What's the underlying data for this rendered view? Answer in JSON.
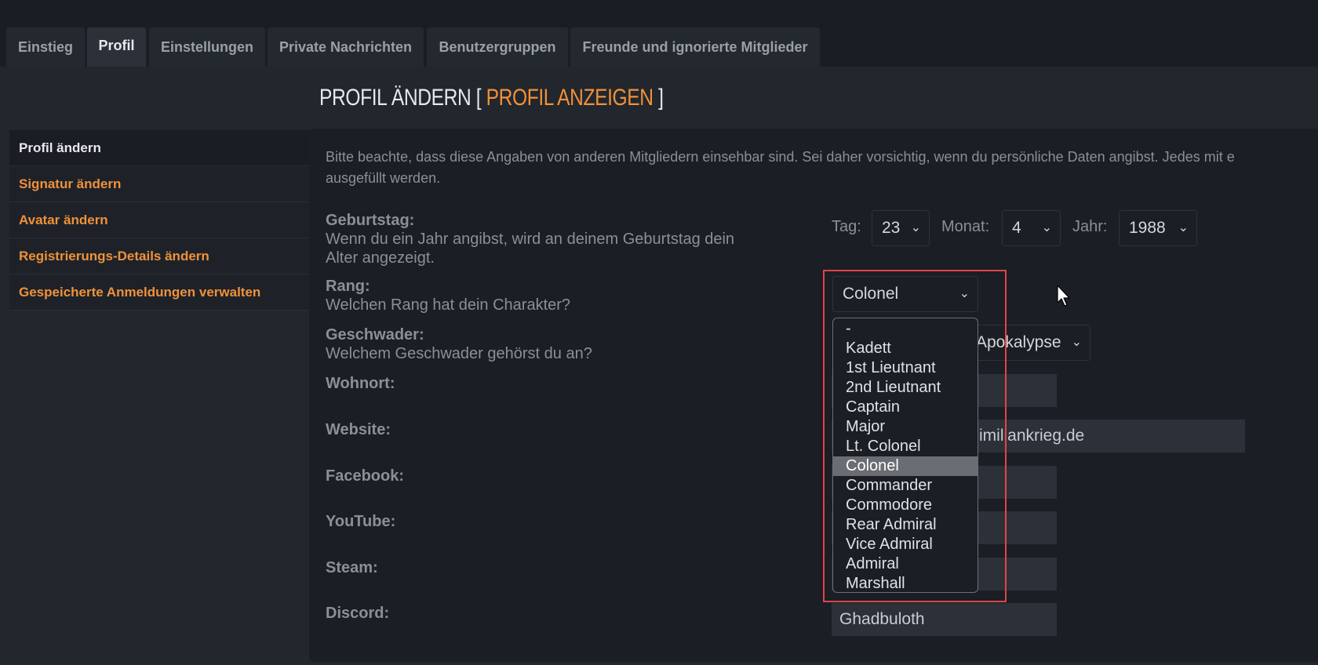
{
  "tabs": [
    {
      "label": "Einstieg"
    },
    {
      "label": "Profil"
    },
    {
      "label": "Einstellungen"
    },
    {
      "label": "Private Nachrichten"
    },
    {
      "label": "Benutzergruppen"
    },
    {
      "label": "Freunde und ignorierte Mitglieder"
    }
  ],
  "title": {
    "main": "PROFIL ÄNDERN",
    "open_bracket": "[",
    "link": "PROFIL ANZEIGEN",
    "close_bracket": "]"
  },
  "sidebar": {
    "items": [
      {
        "label": "Profil ändern"
      },
      {
        "label": "Signatur ändern"
      },
      {
        "label": "Avatar ändern"
      },
      {
        "label": "Registrierungs-Details ändern"
      },
      {
        "label": "Gespeicherte Anmeldungen verwalten"
      }
    ]
  },
  "intro": {
    "line1": "Bitte beachte, dass diese Angaben von anderen Mitgliedern einsehbar sind. Sei daher vorsichtig, wenn du persönliche Daten angibst. Jedes mit e",
    "line2": "ausgefüllt werden."
  },
  "birthday": {
    "label": "Geburtstag:",
    "desc1": "Wenn du ein Jahr angibst, wird an deinem Geburtstag dein",
    "desc2": "Alter angezeigt.",
    "day_label": "Tag:",
    "day_value": "23",
    "month_label": "Monat:",
    "month_value": "4",
    "year_label": "Jahr:",
    "year_value": "1988"
  },
  "rank": {
    "label": "Rang:",
    "desc": "Welchen Rang hat dein Charakter?",
    "value": "Colonel",
    "options": [
      "-",
      "Kadett",
      "1st Lieutnant",
      "2nd Lieutnant",
      "Captain",
      "Major",
      "Lt. Colonel",
      "Colonel",
      "Commander",
      "Commodore",
      "Rear Admiral",
      "Vice Admiral",
      "Admiral",
      "Marshall"
    ]
  },
  "squadron": {
    "label": "Geschwader:",
    "desc": "Welchem Geschwader gehörst du an?",
    "value_visible": "Apokalypse"
  },
  "fields": {
    "wohnort_label": "Wohnort:",
    "website_label": "Website:",
    "website_value_visible": "imiliankrieg.de",
    "facebook_label": "Facebook:",
    "youtube_label": "YouTube:",
    "steam_label": "Steam:",
    "discord_label": "Discord:",
    "discord_value": "Ghadbuloth"
  },
  "colors": {
    "accent": "#f0913a",
    "highlight": "#e04545"
  }
}
